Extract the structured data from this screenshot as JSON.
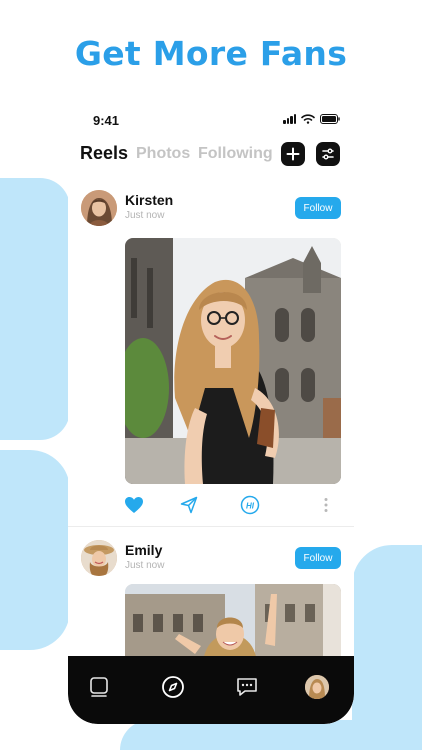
{
  "promo": {
    "title": "Get More Fans"
  },
  "status_bar": {
    "time": "9:41"
  },
  "tabs": [
    {
      "label": "Reels",
      "active": true
    },
    {
      "label": "Photos",
      "active": false
    },
    {
      "label": "Following",
      "active": false
    }
  ],
  "posts": [
    {
      "username": "Kirsten",
      "timestamp": "Just now",
      "follow_label": "Follow"
    },
    {
      "username": "Emily",
      "timestamp": "Just now",
      "follow_label": "Follow"
    }
  ],
  "post_actions": [
    "heart-icon",
    "send-icon",
    "hi-chat-icon",
    "more-vertical-icon"
  ],
  "bottom_nav": [
    "reels-nav-icon",
    "compass-icon",
    "messages-icon",
    "profile-avatar"
  ],
  "colors": {
    "accent": "#25a9ec",
    "title": "#2b9fe8",
    "blob": "#bfe6fa",
    "inactive_tab": "#c4c4c4",
    "nav_bar": "#0a0a0a"
  }
}
